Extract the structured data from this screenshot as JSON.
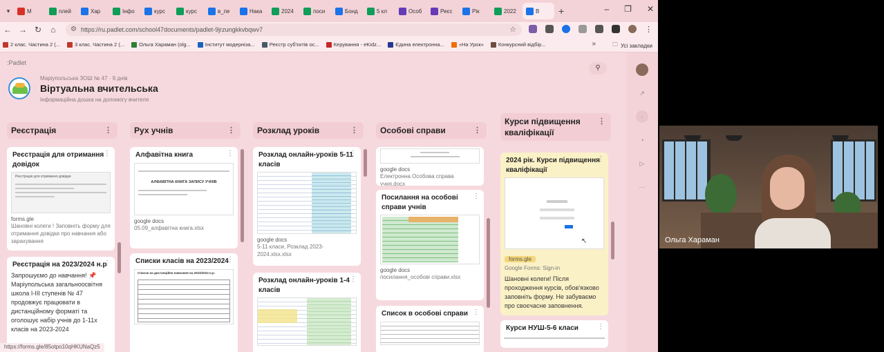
{
  "browser": {
    "tabs": [
      {
        "label": "M",
        "color": "#d93025"
      },
      {
        "label": "плей",
        "color": "#0f9d58"
      },
      {
        "label": "Хар",
        "color": "#1a73e8"
      },
      {
        "label": "Інфо",
        "color": "#0f9d58"
      },
      {
        "label": "курс",
        "color": "#1a73e8"
      },
      {
        "label": "курс",
        "color": "#0f9d58"
      },
      {
        "label": "в_пе",
        "color": "#1a73e8"
      },
      {
        "label": "Нака",
        "color": "#1a73e8"
      },
      {
        "label": "2024",
        "color": "#0f9d58"
      },
      {
        "label": "поси",
        "color": "#0f9d58"
      },
      {
        "label": "Бонд",
        "color": "#1a73e8"
      },
      {
        "label": "5 кл",
        "color": "#0f9d58"
      },
      {
        "label": "Особ",
        "color": "#673ab7"
      },
      {
        "label": "Реєс",
        "color": "#673ab7"
      },
      {
        "label": "Рік",
        "color": "#1a73e8"
      },
      {
        "label": "2022",
        "color": "#0f9d58"
      },
      {
        "label": "В",
        "color": "#1a73e8"
      }
    ],
    "url": "https://ru.padlet.com/school47documents/padlet-9jrzungkkvbqwv7",
    "bookmarks": [
      {
        "label": "2 клас. Частина 2 (...",
        "color": "#c0392b"
      },
      {
        "label": "3 клас. Частина 2 (...",
        "color": "#c0392b"
      },
      {
        "label": "Ольга Хараман (olg...",
        "color": "#2e7d32"
      },
      {
        "label": "Інститут модерніза...",
        "color": "#1565c0"
      },
      {
        "label": "Реєстр суб'єктів ос...",
        "color": "#455a64"
      },
      {
        "label": "Керування - eKidz...",
        "color": "#c62828"
      },
      {
        "label": "Єдина електронна...",
        "color": "#283593"
      },
      {
        "label": "«На Урок»",
        "color": "#ef6c00"
      },
      {
        "label": "Конкурсний відбір...",
        "color": "#6d4c41"
      }
    ],
    "bookmarks_all": "Усі закладки",
    "status_url": "https://forms.gle/85otpo10qHKUNaQz5"
  },
  "padlet": {
    "logo": ":Padlet",
    "school": "Маріупольська ЗОШ № 47 · 9 днів",
    "title": "Віртуальна вчительська",
    "subtitle": "Інформаційна дошка на допомогу вчителя",
    "columns": [
      {
        "title": "Реєстрація",
        "cards": [
          {
            "title": "Реєстрація для отримання довідок",
            "thumb_title": "Реєстрація для отримання довідки",
            "tag": "forms.gle",
            "desc": "Шановні колеги ! Заповніть форму для отримання довідки про навчання або зарахування"
          },
          {
            "title": "Реєстрація на 2023/2024 н.р",
            "body": "Запрошуємо до навчання! 📌 Маріупольська загальноосвітня школа І-ІІІ ступенів № 47 продовжує працювати в дистанційному форматі та оголошує набір учнів до 1-11х класів на 2023-2024"
          }
        ]
      },
      {
        "title": "Рух учнів",
        "cards": [
          {
            "title": "Алфавітна книга",
            "thumb_title": "АЛФАВІТНА КНИГА ЗАПИСУ УЧНІВ",
            "tag": "google docs",
            "desc": "05.09_алфавітна книга.xlsx"
          },
          {
            "title": "Списки класів на 2023/2024",
            "thumb_title": "Список на дистанційне навчання на 2023/2024 н.р."
          }
        ]
      },
      {
        "title": "Розклад уроків",
        "cards": [
          {
            "title": "Розклад онлайн-уроків 5-11 класів",
            "tag": "google docs",
            "desc": "5-11 класи, Розклад 2023-2024.xlsx.xlsx"
          },
          {
            "title": "Розклад онлайн-уроків 1-4 класів"
          }
        ]
      },
      {
        "title": "Особові справи",
        "cards": [
          {
            "title": "",
            "tag": "google docs",
            "desc": "Електронна Особова справа учня.docx"
          },
          {
            "title": "Посилання на особові справи учнів",
            "tag": "google docs",
            "desc": "посилання_особові справи.xlsx"
          },
          {
            "title": "Список в особові справи"
          }
        ]
      },
      {
        "title": "Курси підвищення кваліфікації",
        "cards": [
          {
            "title": "2024 рік. Курси підвищення кваліфікації",
            "tag": "forms.gle",
            "desc": "Google Forms: Sign-in",
            "body": "Шановні колеги! Після проходження курсів, обов'язково заповніть форму. Не забуваємо про своєчасне заповнення."
          },
          {
            "title": "Курси НУШ-5-6 класи"
          }
        ]
      }
    ]
  },
  "video": {
    "name": "Ольга Хараман"
  }
}
